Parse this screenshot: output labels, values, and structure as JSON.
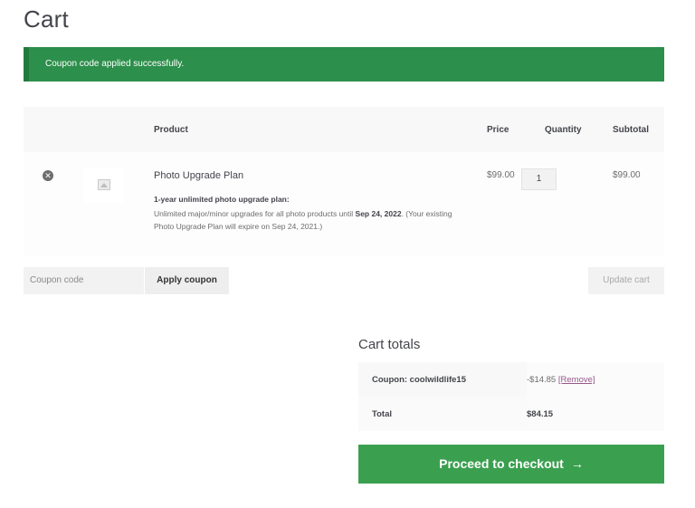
{
  "page": {
    "title": "Cart"
  },
  "notice": {
    "message": "Coupon code applied successfully."
  },
  "cart_table": {
    "headers": {
      "product": "Product",
      "price": "Price",
      "quantity": "Quantity",
      "subtotal": "Subtotal"
    },
    "items": [
      {
        "name": "Photo Upgrade Plan",
        "meta_title": "1-year unlimited photo upgrade plan:",
        "meta_text_1": "Unlimited major/minor upgrades for all photo products until ",
        "meta_text_bold": "Sep 24, 2022",
        "meta_text_2": ". (Your existing Photo Upgrade Plan will expire on Sep 24, 2021.)",
        "price": "$99.00",
        "quantity": "1",
        "subtotal": "$99.00"
      }
    ]
  },
  "actions": {
    "coupon_placeholder": "Coupon code",
    "apply_coupon": "Apply coupon",
    "update_cart": "Update cart"
  },
  "totals": {
    "title": "Cart totals",
    "coupon_label": "Coupon: coolwildlife15",
    "coupon_value": "-$14.85",
    "remove_label": "[Remove]",
    "total_label": "Total",
    "total_value": "$84.15"
  },
  "checkout": {
    "label": "Proceed to checkout",
    "arrow": "→"
  },
  "colors": {
    "notice_bg": "#2c8f4b",
    "checkout_bg": "#3aa04f",
    "link": "#96588a"
  },
  "icons": {
    "remove": "remove-item-icon",
    "thumbnail": "image-placeholder-icon",
    "arrow": "arrow-right-icon"
  }
}
